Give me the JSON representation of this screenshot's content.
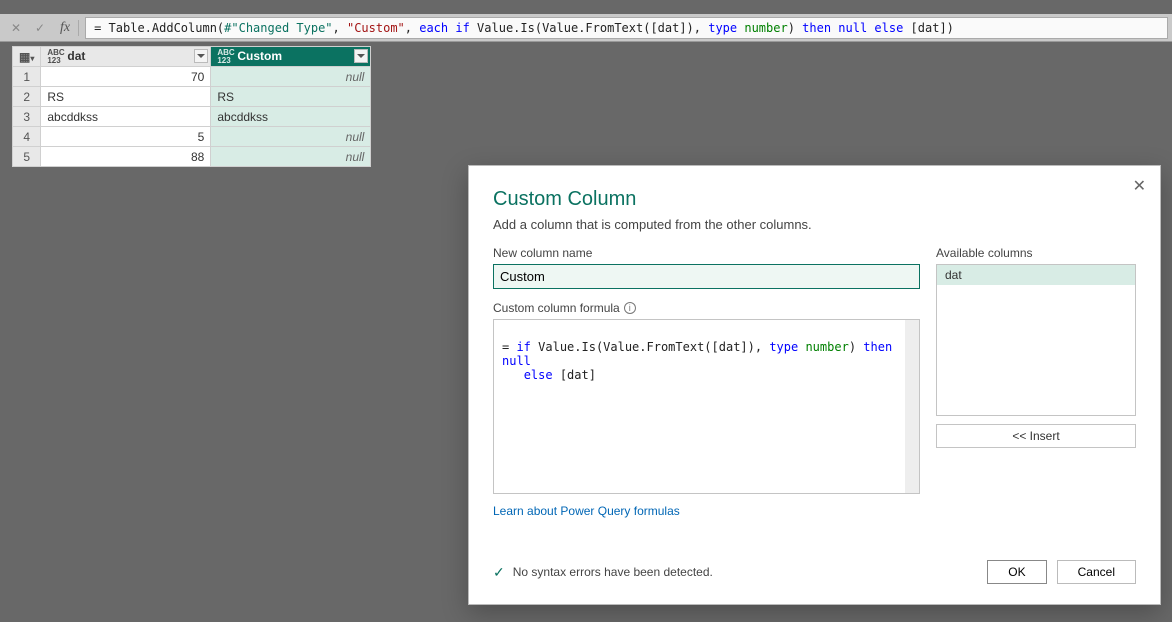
{
  "formula_bar": {
    "prefix": "= Table.AddColumn(",
    "arg1": "#\"Changed Type\"",
    "sep1": ", ",
    "arg2": "\"Custom\"",
    "sep2": ", ",
    "kw_each": "each ",
    "kw_if": "if ",
    "fn1": "Value.Is(Value.FromText([dat]), ",
    "kw_type": "type ",
    "numtype": "number",
    "paren1": ") ",
    "kw_then": "then ",
    "null1": "null ",
    "kw_else": "else ",
    "tail": "[dat])"
  },
  "table": {
    "cols": [
      {
        "type": "ABC\n123",
        "name": "dat"
      },
      {
        "type": "ABC\n123",
        "name": "Custom"
      }
    ],
    "rows": [
      {
        "idx": "1",
        "dat": "70",
        "dat_align": "right",
        "custom": "null",
        "custom_null": true
      },
      {
        "idx": "2",
        "dat": "RS",
        "dat_align": "left",
        "custom": "RS",
        "custom_null": false
      },
      {
        "idx": "3",
        "dat": "abcddkss",
        "dat_align": "left",
        "custom": "abcddkss",
        "custom_null": false
      },
      {
        "idx": "4",
        "dat": "5",
        "dat_align": "right",
        "custom": "null",
        "custom_null": true
      },
      {
        "idx": "5",
        "dat": "88",
        "dat_align": "right",
        "custom": "null",
        "custom_null": true
      }
    ]
  },
  "dialog": {
    "title": "Custom Column",
    "subtitle": "Add a column that is computed from the other columns.",
    "name_label": "New column name",
    "name_value": "Custom",
    "formula_label": "Custom column formula",
    "formula_parts": {
      "p0": "= ",
      "kw_if": "if ",
      "fn": "Value.Is(Value.FromText([dat]), ",
      "kw_type": "type ",
      "numtype": "number",
      "paren": ") ",
      "kw_then": "then ",
      "null1": "null",
      "nl": "\n   ",
      "kw_else": "else ",
      "tail": "[dat]"
    },
    "avail_label": "Available columns",
    "avail_items": [
      "dat"
    ],
    "insert_label": "<< Insert",
    "link_text": "Learn about Power Query formulas",
    "status_text": "No syntax errors have been detected.",
    "ok": "OK",
    "cancel": "Cancel",
    "info_glyph": "i"
  }
}
